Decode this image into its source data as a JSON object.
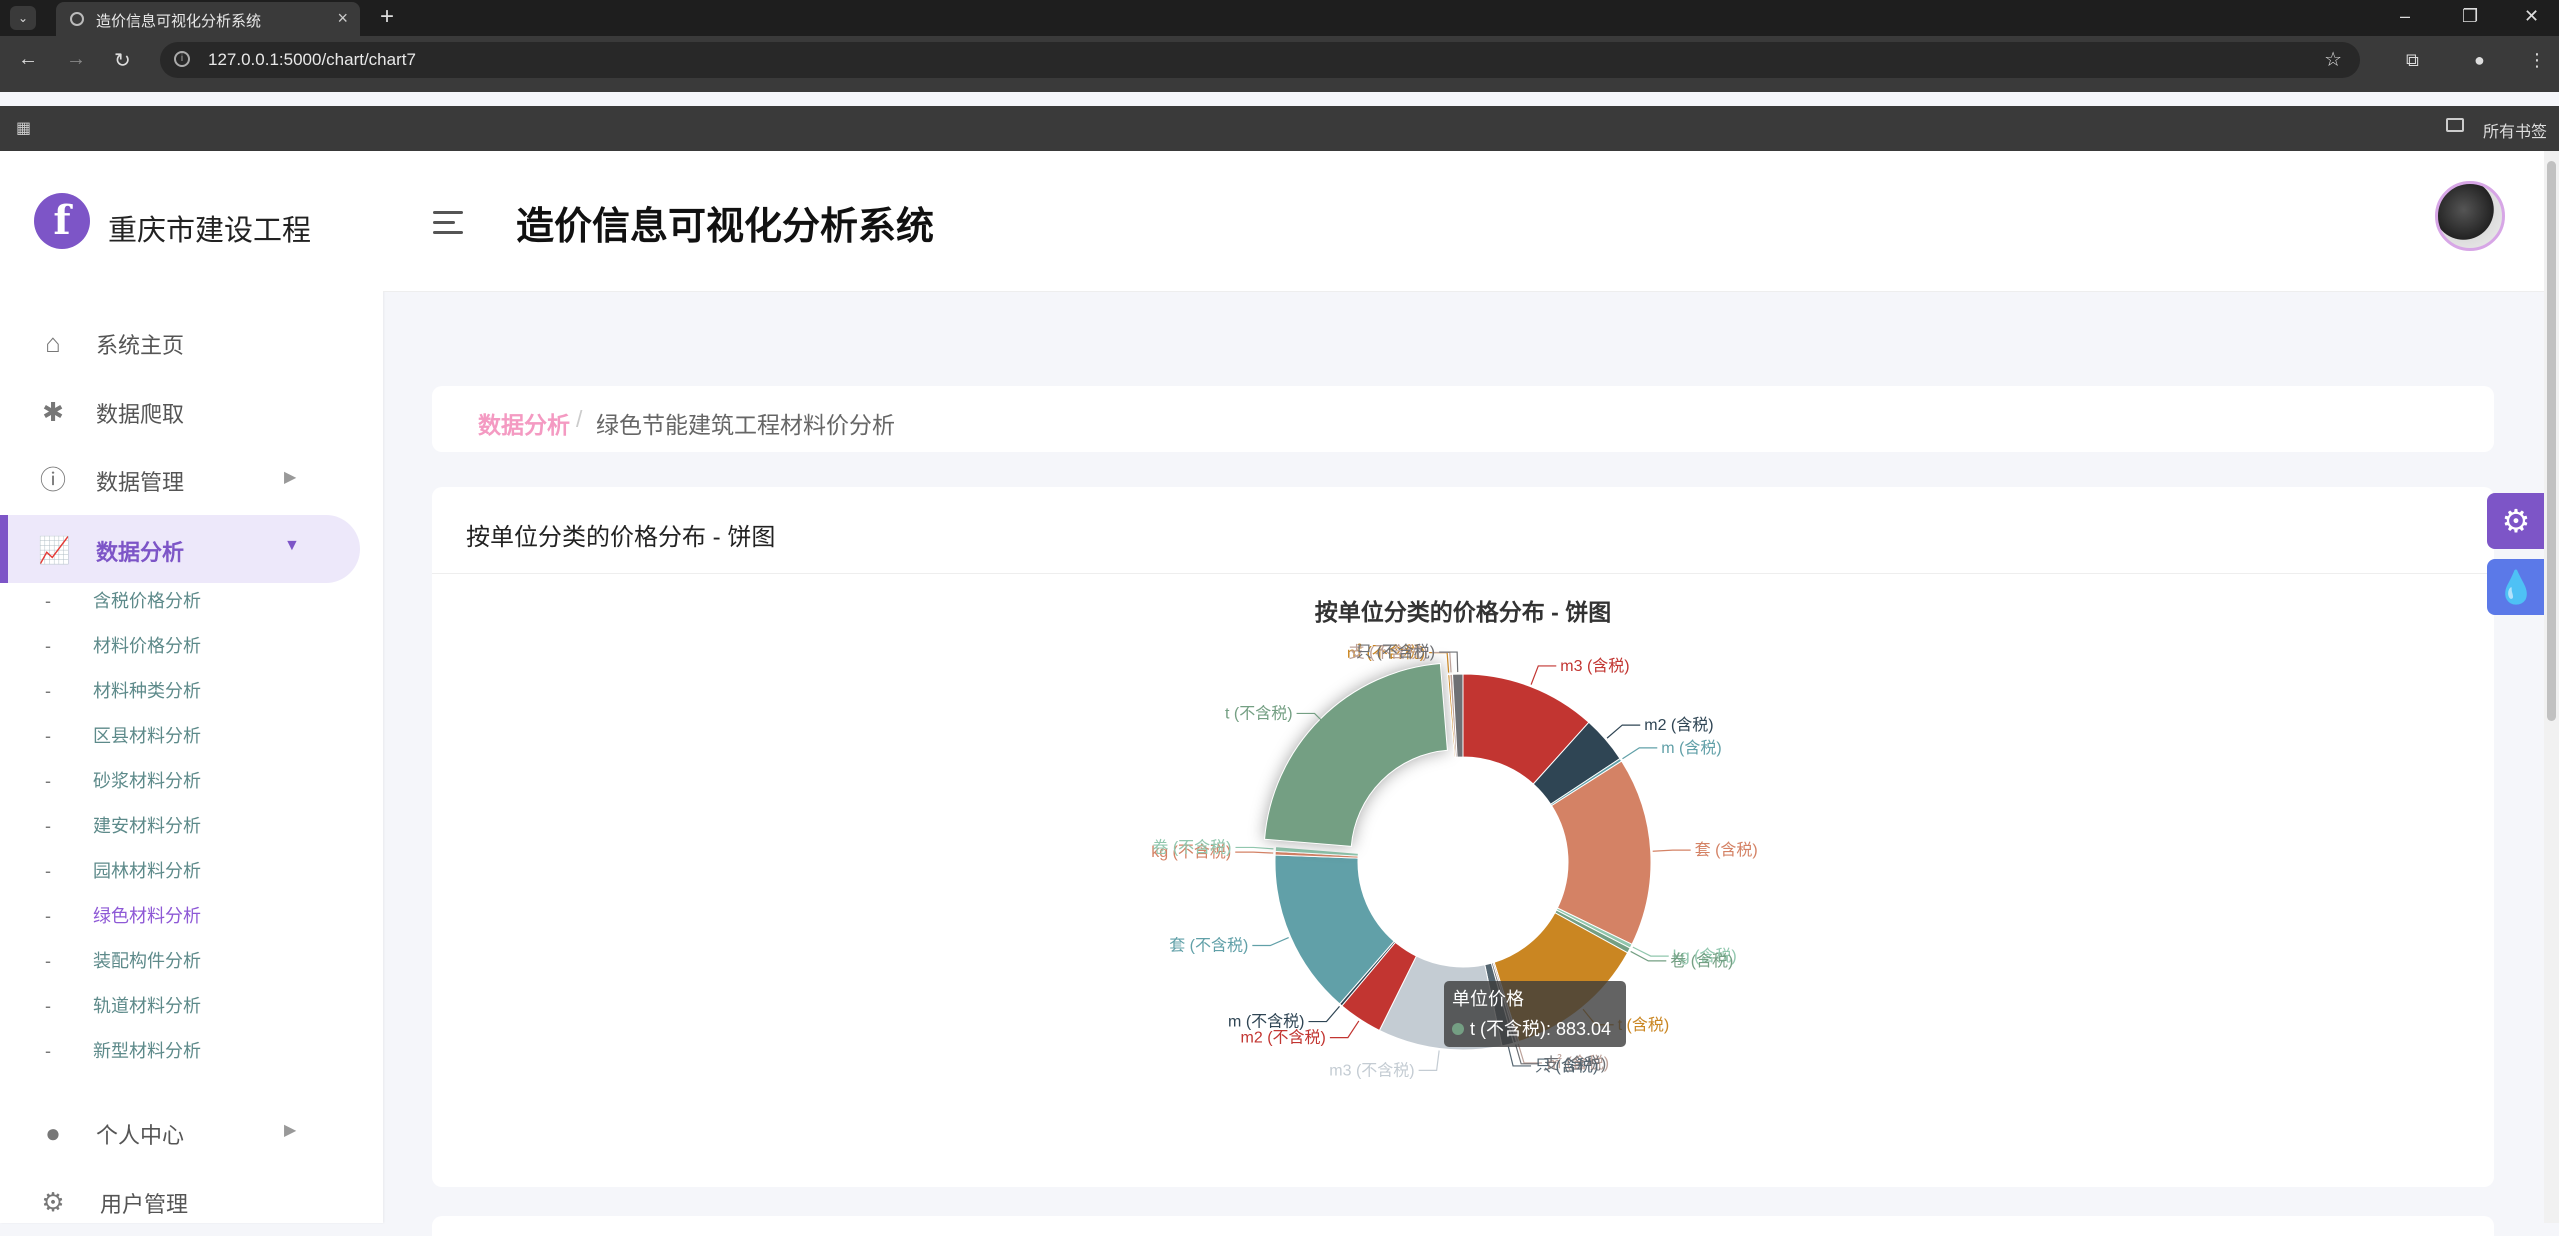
{
  "browser": {
    "tab_title": "造价信息可视化分析系统",
    "url": "127.0.0.1:5000/chart/chart7",
    "bookmarks_label": "所有书签"
  },
  "sidebar": {
    "brand": "重庆市建设工程",
    "nav": [
      {
        "label": "系统主页",
        "icon": "home-icon"
      },
      {
        "label": "数据爬取",
        "icon": "bug-icon"
      },
      {
        "label": "数据管理",
        "icon": "info-icon"
      },
      {
        "label": "数据分析",
        "icon": "chart-icon"
      },
      {
        "label": "个人中心",
        "icon": "user-icon"
      },
      {
        "label": "用户管理",
        "icon": "user-gear-icon"
      }
    ],
    "sub_items": [
      "含税价格分析",
      "材料价格分析",
      "材料种类分析",
      "区县材料分析",
      "砂浆材料分析",
      "建安材料分析",
      "园林材料分析",
      "绿色材料分析",
      "装配构件分析",
      "轨道材料分析",
      "新型材料分析"
    ]
  },
  "header": {
    "title": "造价信息可视化分析系统"
  },
  "breadcrumb": {
    "root": "数据分析",
    "separator": "/",
    "current": "绿色节能建筑工程材料价分析"
  },
  "card": {
    "title": "按单位分类的价格分布 - 饼图"
  },
  "chart_data": {
    "type": "pie",
    "title": "按单位分类的价格分布 - 饼图",
    "series_name": "单位价格",
    "inner_radius_ratio": 0.5,
    "slices": [
      {
        "label": "m3 (含税)",
        "value": 460,
        "color": "#c23531"
      },
      {
        "label": "m2 (含税)",
        "value": 160,
        "color": "#2f4554"
      },
      {
        "label": "m (含税)",
        "value": 10,
        "color": "#61a0a8"
      },
      {
        "label": "套 (含税)",
        "value": 640,
        "color": "#d48265"
      },
      {
        "label": "kg (含税)",
        "value": 14,
        "color": "#91c7ae"
      },
      {
        "label": "卷 (含税)",
        "value": 18,
        "color": "#749f83"
      },
      {
        "label": "t (含税)",
        "value": 480,
        "color": "#ca8622"
      },
      {
        "label": "㎡ (含税)",
        "value": 8,
        "color": "#bda29a"
      },
      {
        "label": "支 (含税)",
        "value": 10,
        "color": "#6e7074"
      },
      {
        "label": "只 (含税)",
        "value": 40,
        "color": "#546570"
      },
      {
        "label": "m3 (不含税)",
        "value": 420,
        "color": "#c4ccd3"
      },
      {
        "label": "m2 (不含税)",
        "value": 150,
        "color": "#c23531"
      },
      {
        "label": "m (不含税)",
        "value": 10,
        "color": "#2f4554"
      },
      {
        "label": "套 (不含税)",
        "value": 560,
        "color": "#61a0a8"
      },
      {
        "label": "kg (不含税)",
        "value": 12,
        "color": "#d48265"
      },
      {
        "label": "卷 (不含税)",
        "value": 16,
        "color": "#91c7ae"
      },
      {
        "label": "t (不含税)",
        "value": 883.04,
        "color": "#749f83"
      },
      {
        "label": "㎡ (不含税)",
        "value": 7,
        "color": "#ca8622"
      },
      {
        "label": "支 (不含税)",
        "value": 9,
        "color": "#bda29a"
      },
      {
        "label": "只 (不含税)",
        "value": 35,
        "color": "#6e7074"
      }
    ],
    "highlighted": "t (不含税)",
    "tooltip": {
      "title": "单位价格",
      "text": "t (不含税): 883.04"
    }
  },
  "colors": {
    "accent": "#7d55c7",
    "breadcrumb_root": "#f49ac2",
    "fab_theme": "#5b79e8"
  }
}
